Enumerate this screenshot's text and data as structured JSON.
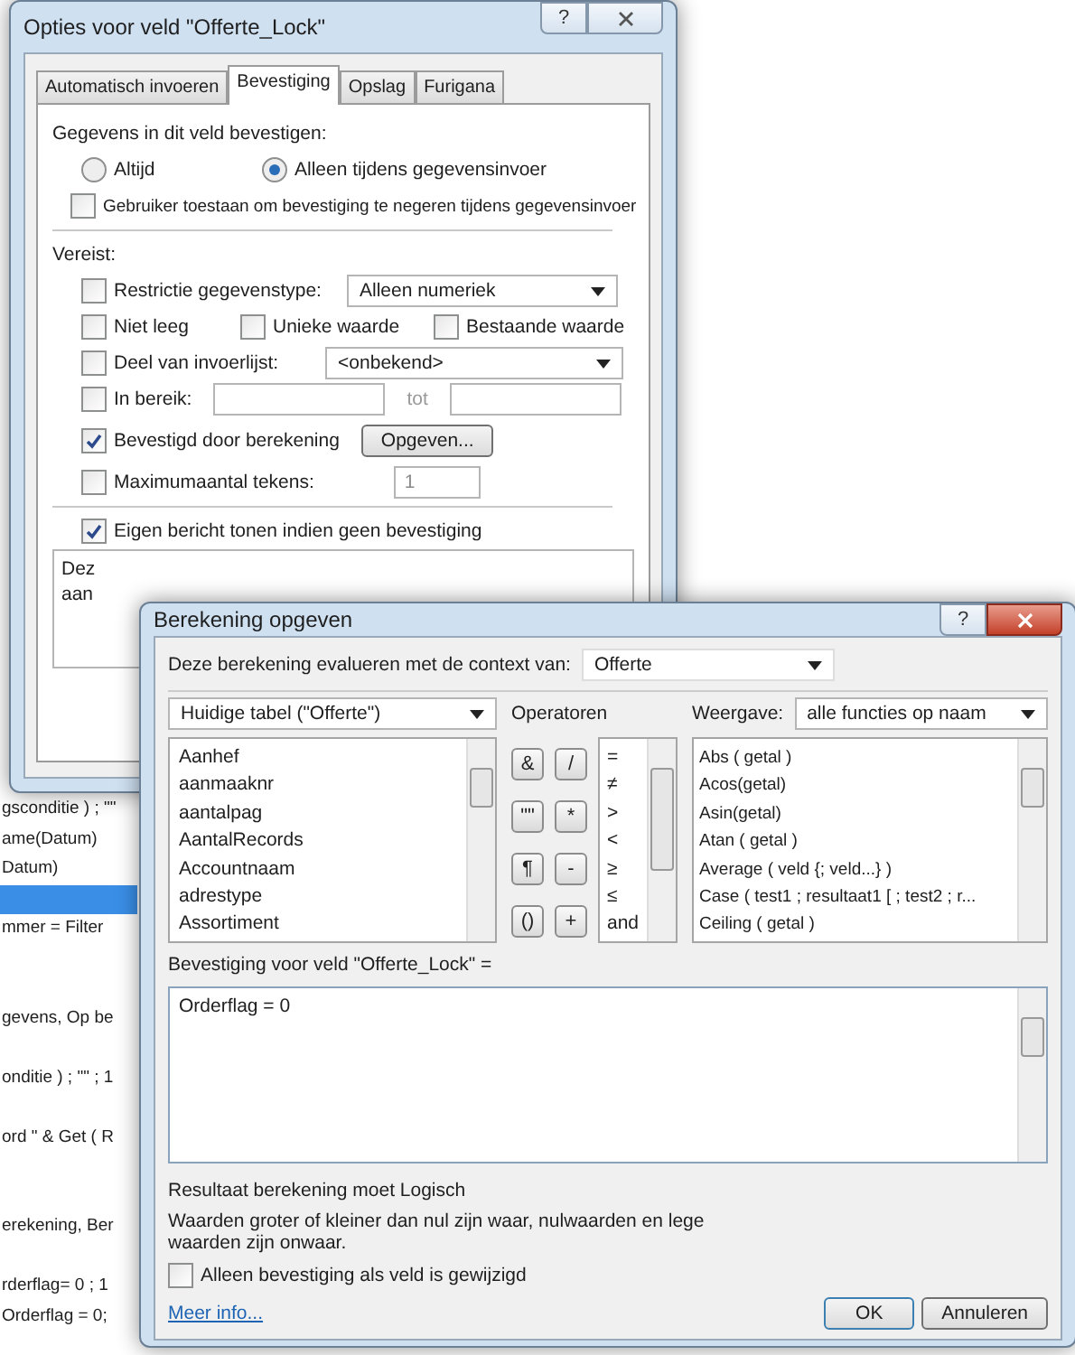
{
  "background_list": {
    "rows": [
      {
        "text": "gsconditie ) ; \"\"",
        "selected": false
      },
      {
        "text": "ame(Datum)",
        "selected": false
      },
      {
        "text": "Datum)",
        "selected": false
      },
      {
        "selected": true
      },
      {
        "text": "mmer = Filter",
        "selected": false
      },
      {
        "selected": false
      },
      {
        "selected": false
      },
      {
        "text": "gevens, Op be",
        "selected": false
      },
      {
        "selected": false
      },
      {
        "text": "onditie ) ; \"\" ; 1",
        "selected": false
      },
      {
        "selected": false
      },
      {
        "text": "ord \" & Get ( R",
        "selected": false
      },
      {
        "selected": false
      },
      {
        "selected": false
      },
      {
        "text": "erekening, Ber",
        "selected": false
      },
      {
        "selected": false
      },
      {
        "text": "rderflag= 0 ; 1",
        "selected": false
      },
      {
        "text": "Orderflag = 0;",
        "selected": false
      }
    ]
  },
  "options_dialog": {
    "title": "Opties voor veld \"Offerte_Lock\"",
    "help": "?",
    "tabs": [
      {
        "label": "Automatisch invoeren",
        "selected": false
      },
      {
        "label": "Bevestiging",
        "selected": true
      },
      {
        "label": "Opslag",
        "selected": false
      },
      {
        "label": "Furigana",
        "selected": false
      }
    ],
    "group_label": "Gegevens in dit veld bevestigen:",
    "radios": [
      {
        "label": "Altijd",
        "selected": false
      },
      {
        "label": "Alleen tijdens gegevensinvoer",
        "selected": true
      }
    ],
    "ignore_checkbox": {
      "label": "Gebruiker toestaan om bevestiging te negeren tijdens gegevensinvoer",
      "checked": false
    },
    "required_label": "Vereist:",
    "restriction": {
      "label": "Restrictie gegevenstype:",
      "checked": false,
      "value": "Alleen numeriek"
    },
    "checks_row": [
      {
        "label": "Niet leeg",
        "checked": false
      },
      {
        "label": "Unieke waarde",
        "checked": false
      },
      {
        "label": "Bestaande waarde",
        "checked": false
      }
    ],
    "value_list": {
      "label": "Deel van invoerlijst:",
      "checked": false,
      "value": "<onbekend>"
    },
    "range": {
      "label": "In bereik:",
      "checked": false,
      "separator": "tot"
    },
    "calculation": {
      "label": "Bevestigd door berekening",
      "checked": true,
      "button": "Opgeven..."
    },
    "max_chars": {
      "label": "Maximumaantal tekens:",
      "checked": false,
      "value": "1",
      "disabled": true
    },
    "custom_message": {
      "label": "Eigen bericht tonen indien geen bevestiging",
      "checked": true
    },
    "message_lines": [
      "Dez",
      "aan"
    ]
  },
  "calc_dialog": {
    "title": "Berekening opgeven",
    "help": "?",
    "context_label": "Deze berekening evalueren met de context van:",
    "context_value": "Offerte",
    "table_select": "Huidige tabel (\"Offerte\")",
    "fields": [
      "Aanhef",
      "aanmaaknr",
      "aantalpag",
      "AantalRecords",
      "Accountnaam",
      "adrestype",
      "Assortiment"
    ],
    "operators_label": "Operatoren",
    "operator_buttons": [
      "&",
      "/",
      "\"\"",
      "*",
      "¶",
      "-",
      "()",
      "+"
    ],
    "comparison_operators": [
      "=",
      "≠",
      ">",
      "<",
      "≥",
      "≤",
      "and"
    ],
    "view_label": "Weergave:",
    "view_value": "alle functies op naam",
    "functions": [
      "Abs ( getal )",
      "Acos(getal)",
      "Asin(getal)",
      "Atan ( getal )",
      "Average ( veld {; veld...} )",
      "Case ( test1 ; resultaat1 [ ; test2 ; r...",
      "Ceiling ( getal )"
    ],
    "formula_label": "Bevestiging voor veld \"Offerte_Lock\" =",
    "formula": "Orderflag = 0",
    "result_note": "Resultaat berekening moet Logisch",
    "explanation": "Waarden groter of kleiner dan nul zijn waar, nulwaarden en lege waarden zijn onwaar.",
    "modified_only": {
      "label": "Alleen bevestiging als veld is gewijzigd",
      "checked": false
    },
    "more_info": "Meer info...",
    "buttons": [
      "OK",
      "Annuleren"
    ]
  }
}
